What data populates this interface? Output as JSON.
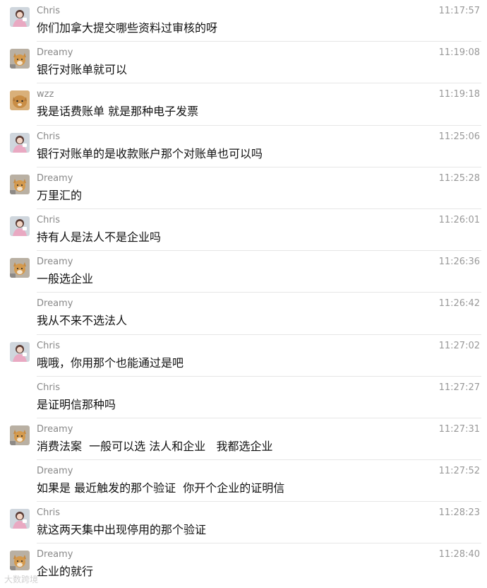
{
  "messages": [
    {
      "sender": "Chris",
      "time": "11:17:57",
      "text": "你们加拿大提交哪些资料过审核的呀",
      "avatar": "chris"
    },
    {
      "sender": "Dreamy",
      "time": "11:19:08",
      "text": "银行对账单就可以",
      "avatar": "dreamy"
    },
    {
      "sender": "wzz",
      "time": "11:19:18",
      "text": "我是话费账单 就是那种电子发票",
      "avatar": "wzz"
    },
    {
      "sender": "Chris",
      "time": "11:25:06",
      "text": "银行对账单的是收款账户那个对账单也可以吗",
      "avatar": "chris"
    },
    {
      "sender": "Dreamy",
      "time": "11:25:28",
      "text": "万里汇的",
      "avatar": "dreamy"
    },
    {
      "sender": "Chris",
      "time": "11:26:01",
      "text": "持有人是法人不是企业吗",
      "avatar": "chris"
    },
    {
      "sender": "Dreamy",
      "time": "11:26:36",
      "text": "一般选企业",
      "avatar": "dreamy"
    },
    {
      "sender": "Dreamy",
      "time": "11:26:42",
      "text": "我从不来不选法人",
      "avatar": "none"
    },
    {
      "sender": "Chris",
      "time": "11:27:02",
      "text": "哦哦，你用那个也能通过是吧",
      "avatar": "chris"
    },
    {
      "sender": "Chris",
      "time": "11:27:27",
      "text": "是证明信那种吗",
      "avatar": "none"
    },
    {
      "sender": "Dreamy",
      "time": "11:27:31",
      "text": "消费法案  一般可以选 法人和企业   我都选企业",
      "avatar": "dreamy"
    },
    {
      "sender": "Dreamy",
      "time": "11:27:52",
      "text": "如果是 最近触发的那个验证  你开个企业的证明信",
      "avatar": "none"
    },
    {
      "sender": "Chris",
      "time": "11:28:23",
      "text": "就这两天集中出现停用的那个验证",
      "avatar": "chris"
    },
    {
      "sender": "Dreamy",
      "time": "11:28:40",
      "text": "企业的就行",
      "avatar": "dreamy"
    }
  ],
  "watermark": "大数跨境"
}
